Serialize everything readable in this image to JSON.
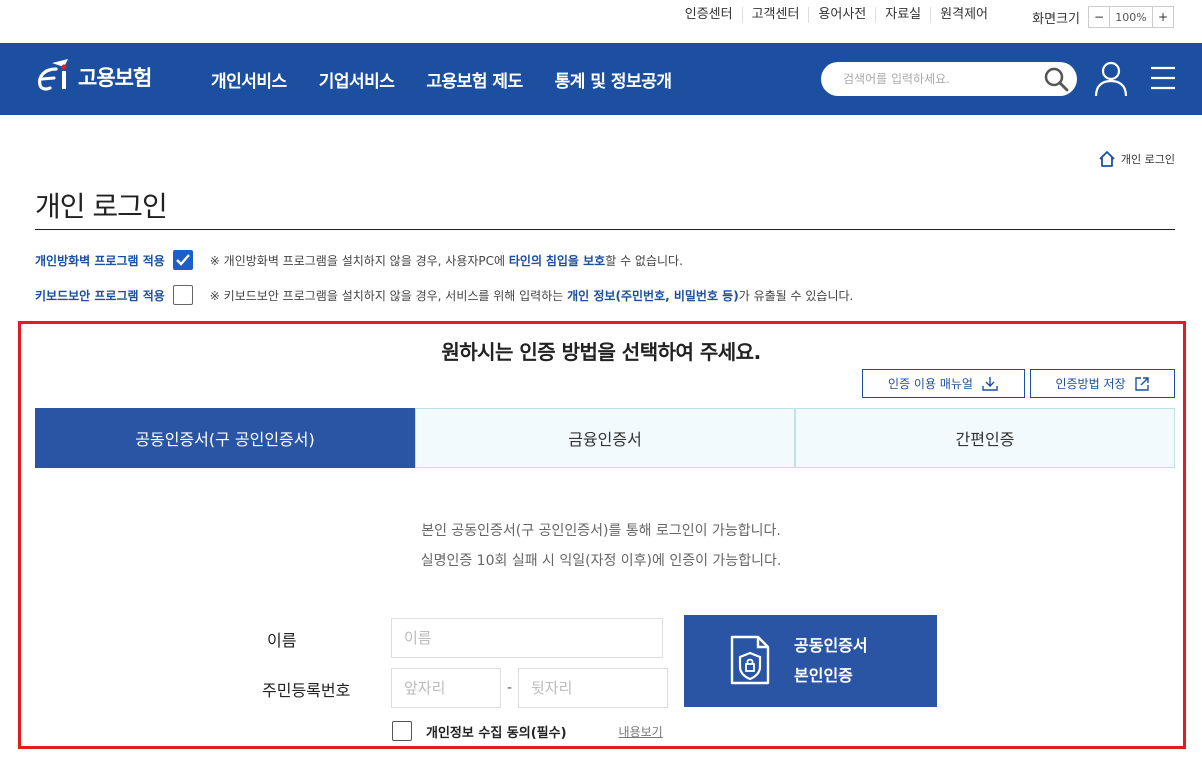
{
  "utility": {
    "links": [
      "인증센터",
      "고객센터",
      "용어사전",
      "자료실",
      "원격제어"
    ],
    "zoom_label": "화면크기",
    "zoom_minus": "−",
    "zoom_value": "100%",
    "zoom_plus": "+"
  },
  "header": {
    "logo_text": "고용보험",
    "nav": [
      "개인서비스",
      "기업서비스",
      "고용보험 제도",
      "통계 및 정보공개"
    ],
    "search_placeholder": "검색어를 입력하세요.",
    "brand_color": "#1c4fa0"
  },
  "breadcrumb": {
    "current": "개인 로그인"
  },
  "page_title": "개인 로그인",
  "options": [
    {
      "label": "개인방화벽 프로그램 적용",
      "checked": true,
      "note_prefix": "※ 개인방화벽 프로그램을 설치하지 않을 경우, 사용자PC에 ",
      "note_bold1": "타인의",
      "note_mid": " ",
      "note_bold2": "침입을 보호",
      "note_suffix": "할 수 없습니다."
    },
    {
      "label": "키보드보안 프로그램 적용",
      "checked": false,
      "note_prefix": "※ 키보드보안 프로그램을 설치하지 않을 경우, 서비스를 위해 입력하는 ",
      "note_bold1": "개인 정보(주민번호, 비밀번호 등)",
      "note_mid": "",
      "note_bold2": "",
      "note_suffix": "가 유출될 수 있습니다."
    }
  ],
  "auth": {
    "heading": "원하시는 인증 방법을 선택하여 주세요.",
    "manual_button": "인증 이용 매뉴얼",
    "save_button": "인증방법 저장",
    "tabs": [
      "공동인증서(구 공인인증서)",
      "금융인증서",
      "간편인증"
    ],
    "active_tab": 0,
    "info_line1": "본인 공동인증서(구 공인인증서)를 통해 로그인이 가능합니다.",
    "info_line2": "실명인증 10회 실패 시 익일(자정 이후)에 인증이 가능합니다."
  },
  "form": {
    "name_label": "이름",
    "name_placeholder": "이름",
    "rrn_label": "주민등록번호",
    "rrn_front_placeholder": "앞자리",
    "rrn_separator": "-",
    "rrn_back_placeholder": "뒷자리",
    "submit_line1": "공동인증서",
    "submit_line2": "본인인증",
    "agree_label": "개인정보 수집 동의(필수)",
    "agree_checked": false,
    "agree_link": "내용보기"
  }
}
